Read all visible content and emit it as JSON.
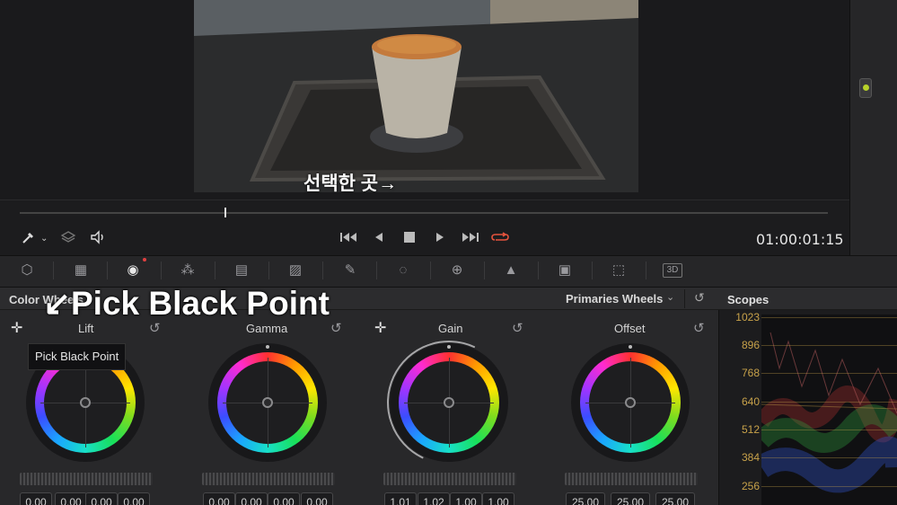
{
  "viewer": {
    "subtitle": "선택한 곳→"
  },
  "transport": {
    "timecode": "01:00:01:15",
    "icons": [
      "eyedropper-icon",
      "chevron-down-icon",
      "layers-icon",
      "speaker-icon",
      "skip-start-icon",
      "play-reverse-icon",
      "stop-icon",
      "play-icon",
      "skip-end-icon",
      "loop-icon"
    ],
    "loop_color": "#e5533d"
  },
  "tools": [
    "camera-raw-icon",
    "color-match-icon",
    "color-wheels-icon",
    "rgb-mixer-icon",
    "motion-effects-icon",
    "curves-icon",
    "qualifier-icon",
    "window-icon",
    "tracker-icon",
    "blur-icon",
    "key-icon",
    "sizing-icon",
    "3d-icon"
  ],
  "panel": {
    "title": "Color Wheels",
    "mode": "Primaries Wheels"
  },
  "annotation": {
    "text": "↙Pick Black Point"
  },
  "tooltip": {
    "text": "Pick Black Point"
  },
  "wheels": [
    {
      "label": "Lift",
      "values": [
        "0.00",
        "0.00",
        "0.00",
        "0.00"
      ]
    },
    {
      "label": "Gamma",
      "values": [
        "0.00",
        "0.00",
        "0.00",
        "0.00"
      ]
    },
    {
      "label": "Gain",
      "values": [
        "1.01",
        "1.02",
        "1.00",
        "1.00"
      ]
    },
    {
      "label": "Offset",
      "values": [
        "25.00",
        "25.00",
        "25.00"
      ]
    }
  ],
  "scopes": {
    "title": "Scopes",
    "scale": [
      "1023",
      "896",
      "768",
      "640",
      "512",
      "384",
      "256"
    ],
    "scale_color": "#c8a24a"
  }
}
